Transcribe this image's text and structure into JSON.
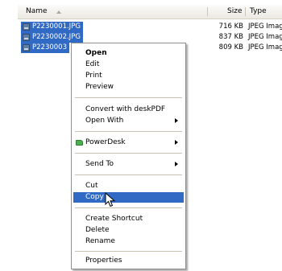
{
  "columns": {
    "name": "Name",
    "size": "Size",
    "type": "Type"
  },
  "files": [
    {
      "name": "P2230001.JPG",
      "size": "716 KB",
      "type": "JPEG Image"
    },
    {
      "name": "P2230002.JPG",
      "size": "837 KB",
      "type": "JPEG Image"
    },
    {
      "name": "P2230003",
      "size": "809 KB",
      "type": "JPEG Image"
    }
  ],
  "menu": {
    "open": "Open",
    "edit": "Edit",
    "print": "Print",
    "preview": "Preview",
    "convert": "Convert with deskPDF",
    "open_with": "Open With",
    "powerdesk": "PowerDesk",
    "send_to": "Send To",
    "cut": "Cut",
    "copy": "Copy",
    "create_shortcut": "Create Shortcut",
    "delete": "Delete",
    "rename": "Rename",
    "properties": "Properties"
  },
  "colors": {
    "selection": "#316ac5",
    "menu_border": "#8f8f8f"
  },
  "icons": {
    "file": "jpeg-file-icon",
    "powerdesk": "powerdesk-folder-icon",
    "submenu": "submenu-arrow-icon",
    "cursor": "mouse-pointer-icon"
  }
}
